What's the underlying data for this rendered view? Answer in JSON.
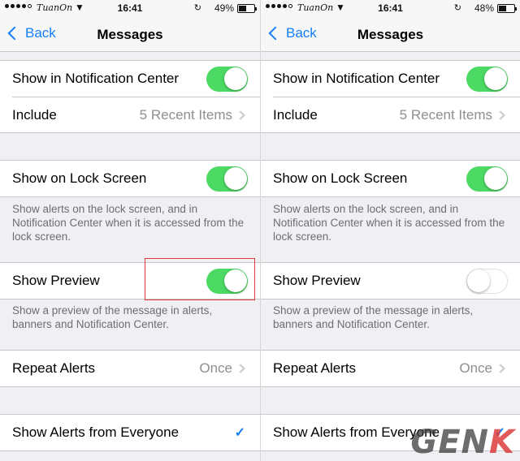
{
  "screens": [
    {
      "status": {
        "carrier": "TuanOn",
        "time": "16:41",
        "battery_pct": "49%",
        "battery_level": 0.49
      },
      "nav": {
        "back_label": "Back",
        "title": "Messages"
      },
      "notification_center": {
        "label": "Show in Notification Center",
        "on": true
      },
      "include": {
        "label": "Include",
        "value": "5 Recent Items"
      },
      "lock_screen": {
        "label": "Show on Lock Screen",
        "on": true,
        "footer": "Show alerts on the lock screen, and in Notification Center when it is accessed from the lock screen."
      },
      "preview": {
        "label": "Show Preview",
        "on": true,
        "footer": "Show a preview of the message in alerts, banners and Notification Center."
      },
      "repeat": {
        "label": "Repeat Alerts",
        "value": "Once"
      },
      "alerts_from": {
        "label": "Show Alerts from Everyone",
        "checked": true
      }
    },
    {
      "status": {
        "carrier": "TuanOn",
        "time": "16:41",
        "battery_pct": "48%",
        "battery_level": 0.48
      },
      "nav": {
        "back_label": "Back",
        "title": "Messages"
      },
      "notification_center": {
        "label": "Show in Notification Center",
        "on": true
      },
      "include": {
        "label": "Include",
        "value": "5 Recent Items"
      },
      "lock_screen": {
        "label": "Show on Lock Screen",
        "on": true,
        "footer": "Show alerts on the lock screen, and in Notification Center when it is accessed from the lock screen."
      },
      "preview": {
        "label": "Show Preview",
        "on": false,
        "footer": "Show a preview of the message in alerts, banners and Notification Center."
      },
      "repeat": {
        "label": "Repeat Alerts",
        "value": "Once"
      },
      "alerts_from": {
        "label": "Show Alerts from Everyone",
        "checked": true
      }
    }
  ],
  "colors": {
    "accent": "#147efb",
    "toggle_on": "#4cd964",
    "highlight": "#e03a3a"
  },
  "watermark": {
    "text_main": "GEN",
    "text_accent": "K"
  }
}
